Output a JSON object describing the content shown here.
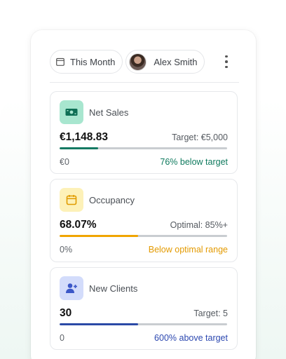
{
  "header": {
    "period_label": "This Month",
    "user_name": "Alex Smith"
  },
  "cards": [
    {
      "title": "Net Sales",
      "value": "€1,148.83",
      "target": "Target: €5,000",
      "progress": 0.23,
      "bar_color": "#157a63",
      "icon_bg": "#a8e6cf",
      "icon_color": "#0e6f55",
      "icon": "cash-icon",
      "left_label": "€0",
      "status": "76% below target",
      "status_color": "#0f7a5e"
    },
    {
      "title": "Occupancy",
      "value": "68.07%",
      "target": "Optimal: 85%+",
      "progress": 0.47,
      "bar_color": "#f0a500",
      "icon_bg": "#fdf1b8",
      "icon_color": "#e09b00",
      "icon": "calendar-icon",
      "left_label": "0%",
      "status": "Below optimal range",
      "status_color": "#e39a00"
    },
    {
      "title": "New Clients",
      "value": "30",
      "target": "Target: 5",
      "progress": 0.47,
      "bar_color": "#2b4aa6",
      "icon_bg": "#d3dcfb",
      "icon_color": "#3b57c8",
      "icon": "add-user-icon",
      "left_label": "0",
      "status": "600% above target",
      "status_color": "#2c48b0"
    }
  ]
}
